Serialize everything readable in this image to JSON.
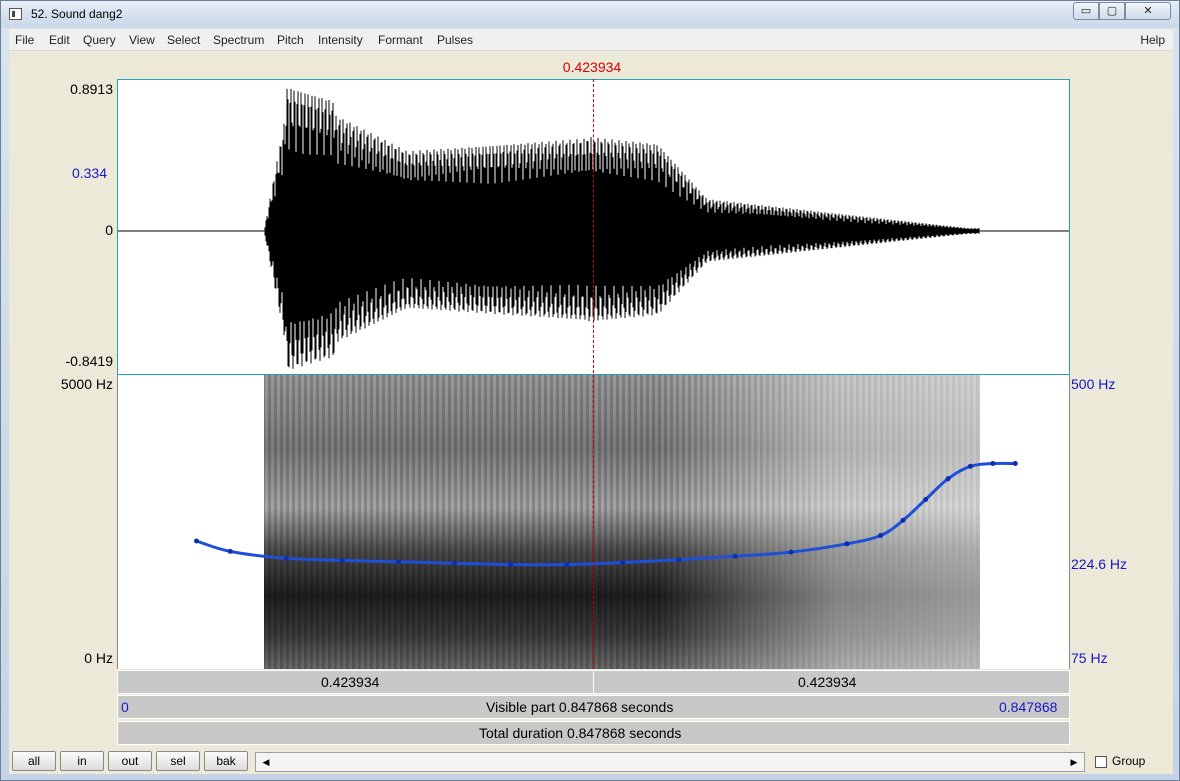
{
  "window": {
    "title": "52. Sound dang2",
    "buttons": {
      "minimize": "▭",
      "maximize": "▢",
      "close": "✕"
    }
  },
  "menubar": {
    "items": [
      "File",
      "Edit",
      "Query",
      "View",
      "Select",
      "Spectrum",
      "Pitch",
      "Intensity",
      "Formant",
      "Pulses"
    ],
    "help": "Help"
  },
  "cursor": {
    "time_label": "0.423934",
    "time_seconds": 0.423934
  },
  "waveform": {
    "y_max": "0.8913",
    "y_cursor": "0.334",
    "y_zero": "0",
    "y_min": "-0.8419"
  },
  "spectrogram": {
    "freq_top": "5000 Hz",
    "freq_bottom": "0 Hz",
    "pitch_top": "500 Hz",
    "pitch_cursor": "224.6 Hz",
    "pitch_bottom": "75 Hz"
  },
  "chart_data": {
    "type": "line",
    "series": [
      {
        "x": [
          0.07,
          0.1,
          0.15,
          0.2,
          0.25,
          0.3,
          0.35,
          0.4,
          0.45,
          0.5,
          0.55,
          0.6,
          0.65,
          0.68,
          0.7,
          0.72,
          0.74,
          0.76,
          0.78,
          0.8
        ],
        "values": [
          260,
          245,
          235,
          232,
          230,
          228,
          226,
          226,
          229,
          233,
          238,
          244,
          256,
          268,
          290,
          320,
          350,
          368,
          372,
          372
        ]
      }
    ],
    "xlim": [
      0,
      0.847868
    ],
    "ylim": [
      75,
      500
    ]
  },
  "time_bars": {
    "left_segment": "0.423934",
    "right_segment": "0.423934",
    "visible_start": "0",
    "visible_text": "Visible part 0.847868 seconds",
    "visible_end": "0.847868",
    "total_text": "Total duration 0.847868 seconds"
  },
  "toolbar": {
    "buttons": [
      "all",
      "in",
      "out",
      "sel",
      "bak"
    ],
    "group_label": "Group"
  }
}
